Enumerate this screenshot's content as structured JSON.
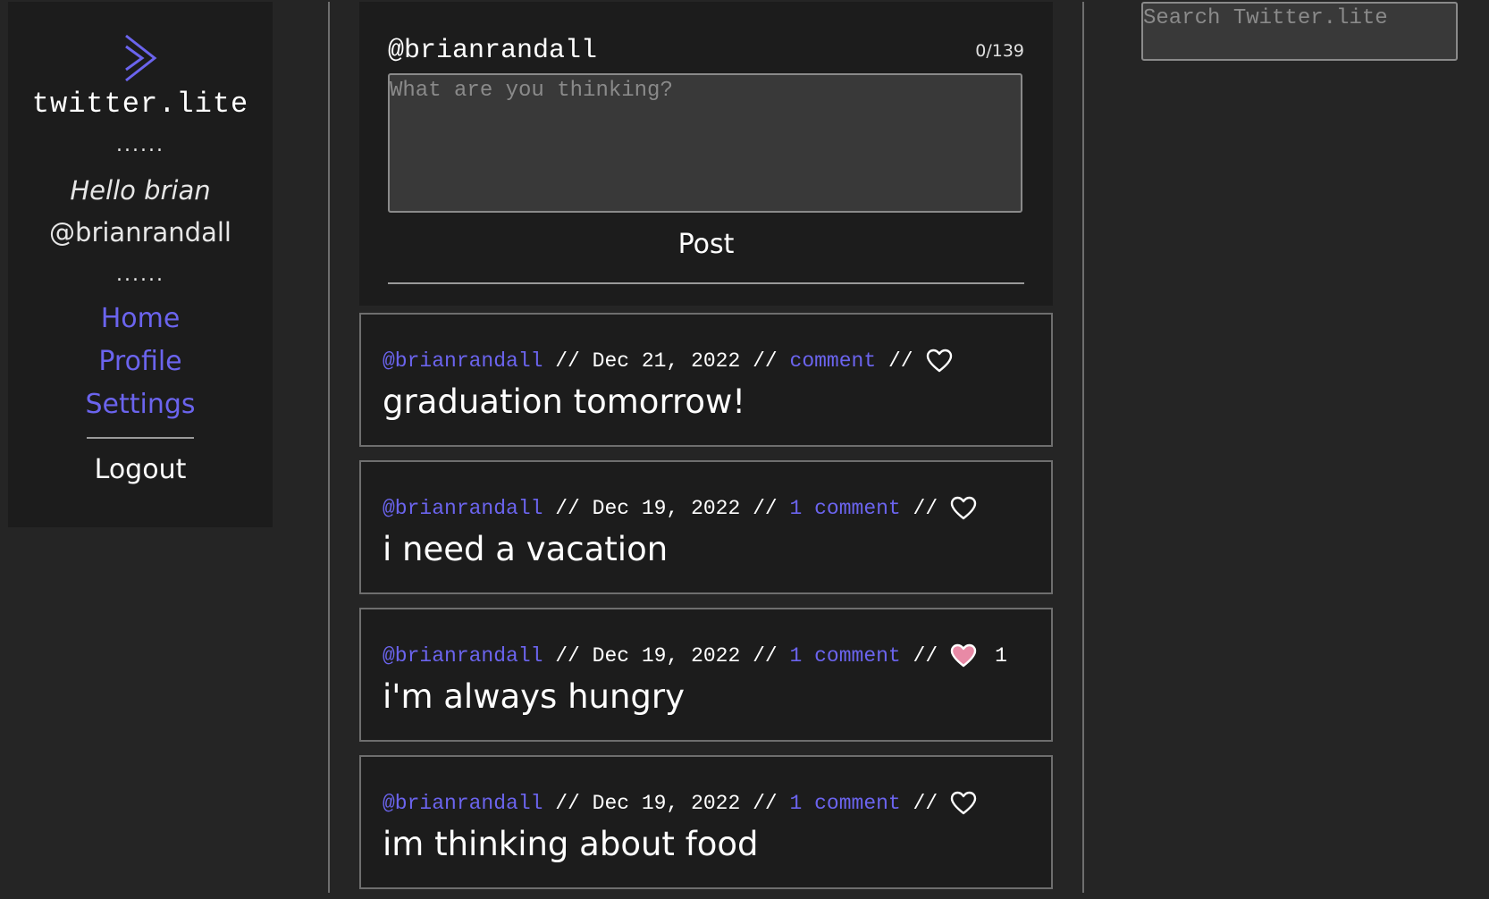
{
  "colors": {
    "background": "#252525",
    "panel": "#1c1c1c",
    "accent": "#6b64ee",
    "heart_liked": "#e88aa6",
    "text": "#ffffff"
  },
  "sidebar": {
    "logo_icon": "chevron-right-icon",
    "brand": "twitter.lite",
    "dots_top": "......",
    "greeting": "Hello brian",
    "handle": "@brianrandall",
    "dots_bottom": "......",
    "nav": {
      "home": "Home",
      "profile": "Profile",
      "settings": "Settings"
    },
    "logout": "Logout"
  },
  "compose": {
    "username": "@brianrandall",
    "counter": "0/139",
    "placeholder": "What are you thinking?",
    "post_label": "Post"
  },
  "search": {
    "placeholder": "Search Twitter.lite"
  },
  "tweets": [
    {
      "author": "@brianrandall",
      "date": "Dec 21, 2022",
      "comment_label": "comment",
      "liked": false,
      "like_count": "",
      "text": "graduation tomorrow!"
    },
    {
      "author": "@brianrandall",
      "date": "Dec 19, 2022",
      "comment_label": "1 comment",
      "liked": false,
      "like_count": "",
      "text": "i need a vacation"
    },
    {
      "author": "@brianrandall",
      "date": "Dec 19, 2022",
      "comment_label": "1 comment",
      "liked": true,
      "like_count": "1",
      "text": "i'm always hungry"
    },
    {
      "author": "@brianrandall",
      "date": "Dec 19, 2022",
      "comment_label": "1 comment",
      "liked": false,
      "like_count": "",
      "text": "im thinking about food"
    }
  ]
}
